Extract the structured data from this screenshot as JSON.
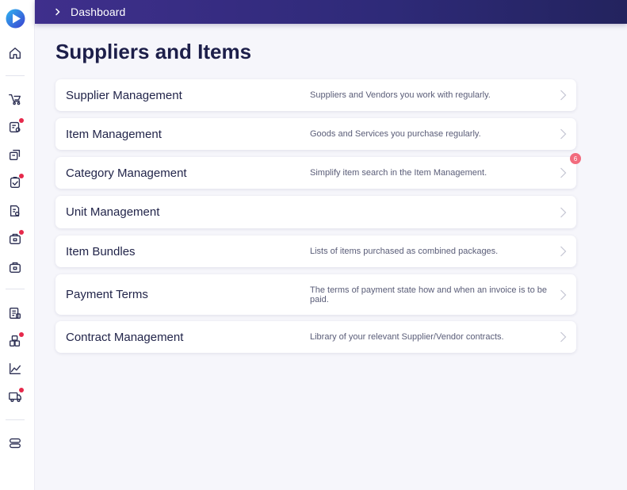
{
  "breadcrumb": {
    "label": "Dashboard"
  },
  "page": {
    "title": "Suppliers and Items"
  },
  "cards": [
    {
      "title": "Supplier Management",
      "description": "Suppliers and Vendors you work with regularly."
    },
    {
      "title": "Item Management",
      "description": "Goods and Services you purchase regularly."
    },
    {
      "title": "Category Management",
      "description": "Simplify item search in the Item Management.",
      "badge": "6"
    },
    {
      "title": "Unit Management",
      "description": ""
    },
    {
      "title": "Item Bundles",
      "description": "Lists of items purchased as combined packages."
    },
    {
      "title": "Payment Terms",
      "description": "The terms of payment state how and when an invoice is to be paid."
    },
    {
      "title": "Contract Management",
      "description": "Library of your relevant Supplier/Vendor contracts."
    }
  ],
  "sidebar": {
    "icons": [
      {
        "name": "home-icon"
      },
      {
        "name": "cart-icon"
      },
      {
        "name": "requisition-icon",
        "notification": true
      },
      {
        "name": "approvals-icon"
      },
      {
        "name": "order-check-icon",
        "notification": true
      },
      {
        "name": "invoice-icon"
      },
      {
        "name": "receiving-icon",
        "notification": true
      },
      {
        "name": "inventory-icon"
      },
      {
        "name": "accounting-icon"
      },
      {
        "name": "assets-icon",
        "notification": true
      },
      {
        "name": "analytics-icon"
      },
      {
        "name": "delivery-icon",
        "notification": true
      },
      {
        "name": "settings-icon"
      }
    ]
  },
  "colors": {
    "accent": "#2e2a78",
    "notification": "#e6294b",
    "badge": "#f26b7d"
  }
}
